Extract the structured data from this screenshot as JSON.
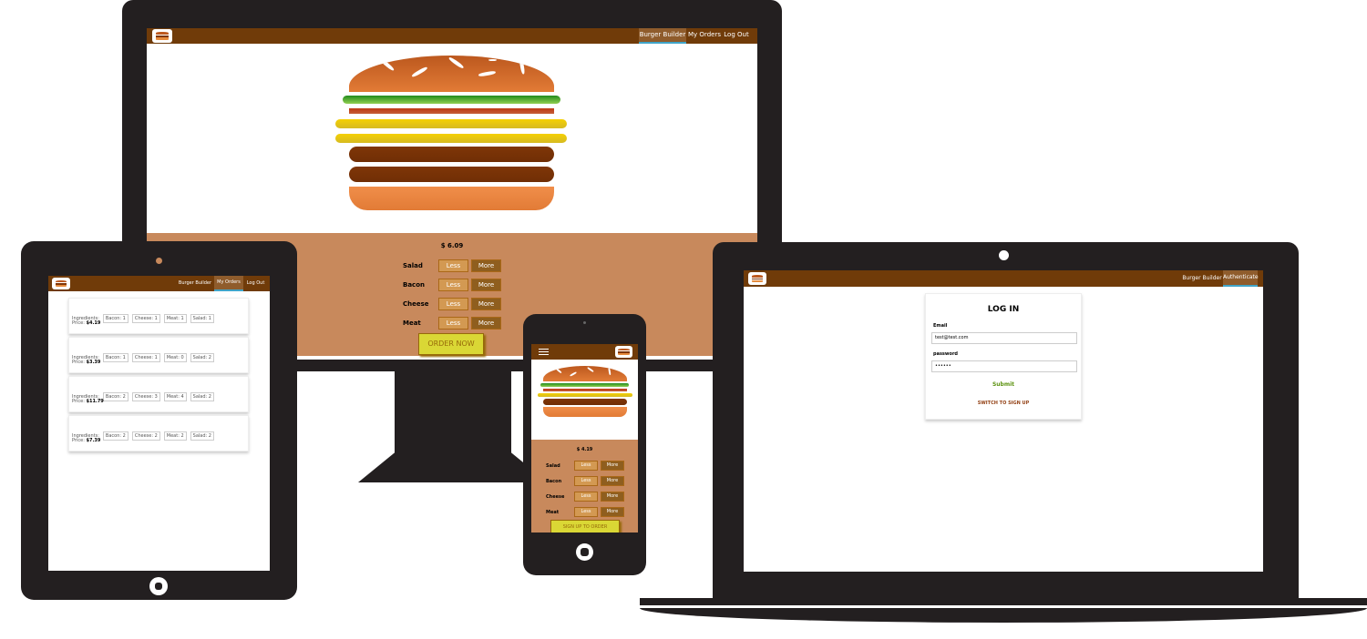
{
  "nav": {
    "burger_builder": "Burger Builder",
    "my_orders": "My Orders",
    "log_out": "Log Out",
    "authenticate": "Authenticate"
  },
  "builder": {
    "price_desktop": "$ 6.09",
    "price_phone": "$ 4.19",
    "controls": [
      {
        "label": "Salad"
      },
      {
        "label": "Bacon"
      },
      {
        "label": "Cheese"
      },
      {
        "label": "Meat"
      }
    ],
    "less_label": "Less",
    "more_label": "More",
    "order_now": "ORDER NOW",
    "sign_up_to_order": "SIGN UP TO ORDER"
  },
  "orders": {
    "ingredients_label": "Ingredients:",
    "price_label": "Price:",
    "items": [
      {
        "ing": [
          "Bacon: 1",
          "Cheese: 1",
          "Meat: 1",
          "Salad: 1"
        ],
        "price": "$4.19"
      },
      {
        "ing": [
          "Bacon: 1",
          "Cheese: 1",
          "Meat: 0",
          "Salad: 2"
        ],
        "price": "$3.39"
      },
      {
        "ing": [
          "Bacon: 2",
          "Cheese: 3",
          "Meat: 4",
          "Salad: 2"
        ],
        "price": "$11.79"
      },
      {
        "ing": [
          "Bacon: 2",
          "Cheese: 2",
          "Meat: 2",
          "Salad: 2"
        ],
        "price": "$7.39"
      }
    ]
  },
  "auth": {
    "title": "LOG IN",
    "email_label": "Email",
    "email_value": "test@test.com",
    "password_label": "password",
    "password_value": "••••••",
    "submit": "Submit",
    "switch": "SWITCH TO SIGN UP"
  },
  "colors": {
    "toolbar": "#703b09",
    "device": "#231f20",
    "controls_bg": "#cf8f2e",
    "order_button": "#dad735",
    "submit": "#5c9210",
    "switch": "#944317"
  }
}
